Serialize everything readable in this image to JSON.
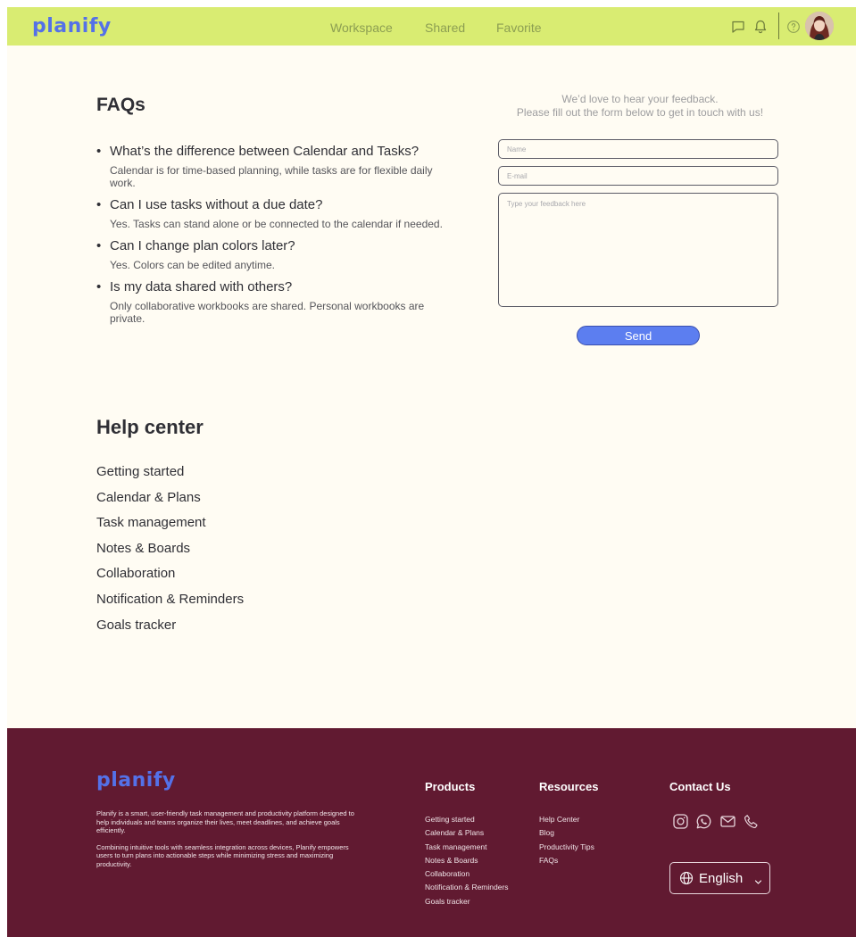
{
  "brand": {
    "name": "planify",
    "color": "#5471e8"
  },
  "colors": {
    "topbar": "#d9ec72",
    "background": "#fffcf3",
    "footer": "#611a31",
    "accent": "#5c7ef0"
  },
  "nav": {
    "items": [
      {
        "label": "Workspace"
      },
      {
        "label": "Shared"
      },
      {
        "label": "Favorite"
      }
    ],
    "icons": [
      "chat-icon",
      "bell-icon",
      "help-icon",
      "avatar"
    ]
  },
  "faq": {
    "title": "FAQs",
    "items": [
      {
        "q": "What’s the difference between Calendar and Tasks?",
        "a": "Calendar is for time-based planning, while tasks are for flexible daily work."
      },
      {
        "q": "Can I use tasks without a due date?",
        "a": "Yes. Tasks can stand alone or be connected to the calendar if needed."
      },
      {
        "q": "Can I change plan colors later?",
        "a": "Yes. Colors can be edited anytime."
      },
      {
        "q": "Is my data shared with others?",
        "a": "Only collaborative workbooks are shared. Personal workbooks are private."
      }
    ]
  },
  "feedback": {
    "line1": "We’d love to hear your feedback.",
    "line2": "Please fill out the form below to get in touch with us!",
    "name_placeholder": "Name",
    "email_placeholder": "E-mail",
    "message_placeholder": "Type your feedback here",
    "send_label": "Send"
  },
  "help": {
    "title": "Help center",
    "items": [
      "Getting started",
      "Calendar & Plans",
      "Task management",
      "Notes & Boards",
      "Collaboration",
      "Notification & Reminders",
      "Goals tracker"
    ]
  },
  "footer": {
    "logo": "planify",
    "about1": "Planify is a smart, user-friendly task management and productivity platform designed to help individuals and teams organize their lives, meet deadlines, and achieve goals efficiently.",
    "about2": "Combining intuitive tools with seamless integration across devices, Planify empowers users to turn plans into actionable steps while minimizing stress and maximizing productivity.",
    "products_title": "Products",
    "products": [
      "Getting started",
      "Calendar & Plans",
      "Task management",
      "Notes & Boards",
      "Collaboration",
      "Notification & Reminders",
      "Goals tracker"
    ],
    "resources_title": "Resources",
    "resources": [
      "Help Center",
      "Blog",
      "Productivity Tips",
      "FAQs"
    ],
    "contact_title": "Contact Us",
    "contact_icons": [
      "instagram-icon",
      "whatsapp-icon",
      "mail-icon",
      "phone-icon"
    ],
    "language": "English"
  }
}
